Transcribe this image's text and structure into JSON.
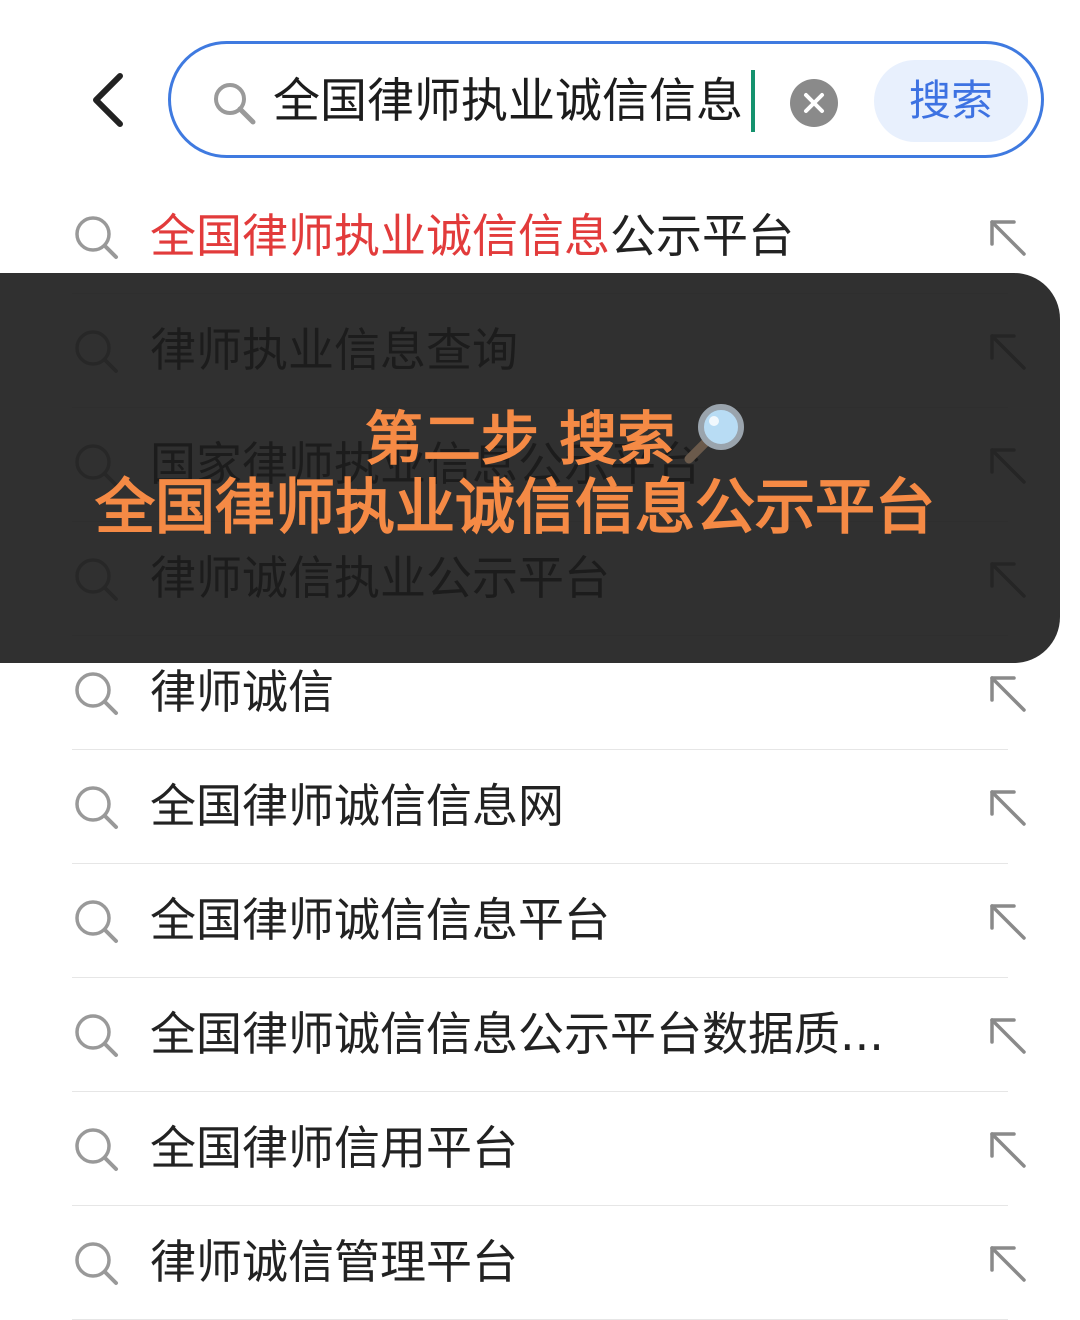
{
  "search": {
    "query": "全国律师执业诚信信息",
    "button_label": "搜索"
  },
  "suggestions": [
    {
      "highlight": "全国律师执业诚信信息",
      "rest": "公示平台"
    },
    {
      "highlight": "",
      "rest": "律师执业信息查询"
    },
    {
      "highlight": "",
      "rest": "国家律师执业信息公示平台"
    },
    {
      "highlight": "",
      "rest": "律师诚信执业公示平台"
    },
    {
      "highlight": "",
      "rest": "律师诚信"
    },
    {
      "highlight": "",
      "rest": "全国律师诚信信息网"
    },
    {
      "highlight": "",
      "rest": "全国律师诚信信息平台"
    },
    {
      "highlight": "",
      "rest": "全国律师诚信信息公示平台数据质..."
    },
    {
      "highlight": "",
      "rest": "全国律师信用平台"
    },
    {
      "highlight": "",
      "rest": "律师诚信管理平台"
    }
  ],
  "overlay": {
    "line1": "第二步 搜索",
    "line2": "全国律师执业诚信信息公示平台"
  },
  "colors": {
    "accent": "#3f7ae0",
    "highlight": "#e23b3b",
    "overlay_text": "#f58a45"
  },
  "icons": [
    "back-arrow-icon",
    "search-icon",
    "clear-icon",
    "fill-arrow-icon",
    "magnifier-emoji-icon"
  ]
}
